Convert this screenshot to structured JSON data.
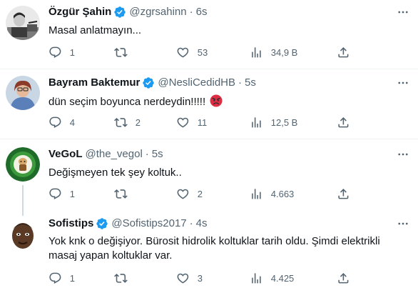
{
  "colors": {
    "verified": "#1d9bf0",
    "muted": "#536471",
    "text": "#0f1419",
    "divider": "#eff3f4",
    "thread_line": "#cfd9de"
  },
  "tweets": [
    {
      "name": "Özgür Şahin",
      "handle": "@zgrsahinn",
      "separator": "·",
      "time": "6s",
      "text": "Masal anlatmayın...",
      "reply_count": "1",
      "retweet_count": "",
      "like_count": "53",
      "views_count": "34,9 B",
      "verified": true
    },
    {
      "name": "Bayram Baktemur",
      "handle": "@NesliCedidHB",
      "separator": "·",
      "time": "5s",
      "text": "dün seçim boyunca nerdeydin!!!!!",
      "emoji": "angry-face",
      "reply_count": "4",
      "retweet_count": "2",
      "like_count": "11",
      "views_count": "12,5 B",
      "verified": true
    },
    {
      "name": "VeGoL",
      "handle": "@the_vegol",
      "separator": "·",
      "time": "5s",
      "text": "Değişmeyen tek şey koltuk..",
      "reply_count": "1",
      "retweet_count": "",
      "like_count": "2",
      "views_count": "4.663",
      "verified": false
    },
    {
      "name": "Sofistips",
      "handle": "@Sofistips2017",
      "separator": "·",
      "time": "4s",
      "text": "Yok knk o değişiyor. Bürosit hidrolik koltuklar tarih oldu. Şimdi elektrikli masaj yapan koltuklar var.",
      "reply_count": "1",
      "retweet_count": "",
      "like_count": "3",
      "views_count": "4.425",
      "verified": true
    }
  ]
}
